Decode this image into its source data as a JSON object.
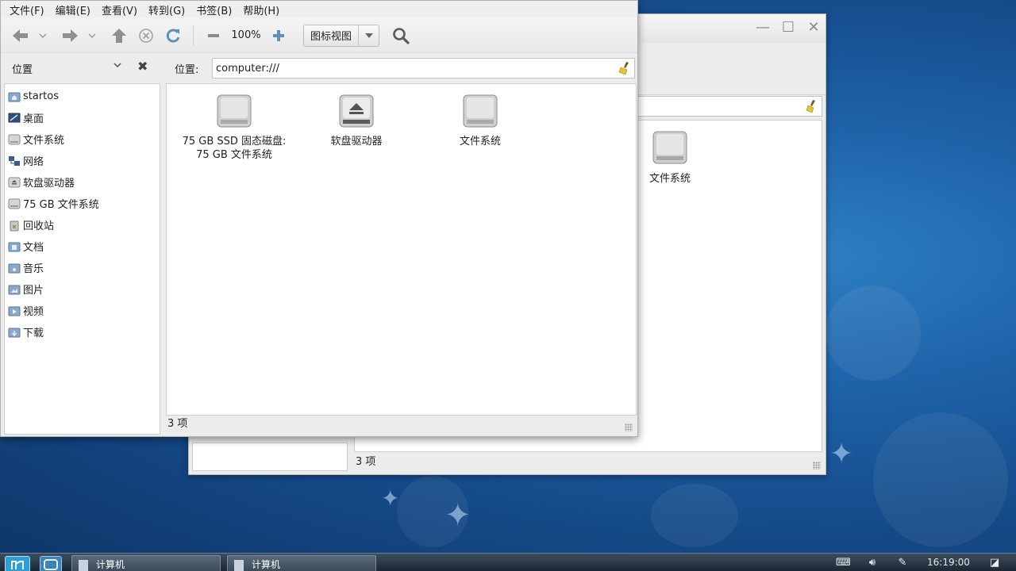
{
  "back_window": {
    "controls": {
      "minimize": "—",
      "maximize": "☐",
      "close": "✕"
    },
    "items": [
      {
        "label": "文件系统"
      }
    ],
    "status": "3 项"
  },
  "menubar": {
    "items": [
      "文件(F)",
      "编辑(E)",
      "查看(V)",
      "转到(G)",
      "书签(B)",
      "帮助(H)"
    ]
  },
  "toolbar": {
    "zoom_level": "100%",
    "view_mode": "图标视图"
  },
  "sidebar": {
    "title": "位置",
    "items": [
      {
        "label": "startos",
        "icon": "home-folder-icon"
      },
      {
        "label": "桌面",
        "icon": "desktop-icon"
      },
      {
        "label": "文件系统",
        "icon": "drive-icon"
      },
      {
        "label": "网络",
        "icon": "network-icon"
      },
      {
        "label": "软盘驱动器",
        "icon": "floppy-icon"
      },
      {
        "label": "75 GB 文件系统",
        "icon": "drive-icon"
      },
      {
        "label": "回收站",
        "icon": "trash-icon"
      },
      {
        "label": "文档",
        "icon": "folder-icon"
      },
      {
        "label": "音乐",
        "icon": "folder-icon"
      },
      {
        "label": "图片",
        "icon": "folder-icon"
      },
      {
        "label": "视频",
        "icon": "folder-icon"
      },
      {
        "label": "下载",
        "icon": "folder-icon"
      }
    ]
  },
  "location": {
    "label": "位置:",
    "value": "computer:///"
  },
  "content": {
    "items": [
      {
        "label": "75 GB SSD 固态磁盘:",
        "label2": "75 GB 文件系统",
        "icon": "drive-icon"
      },
      {
        "label": "软盘驱动器",
        "label2": "",
        "icon": "eject-drive-icon"
      },
      {
        "label": "文件系统",
        "label2": "",
        "icon": "drive-icon"
      }
    ]
  },
  "status": {
    "text": "3 项"
  },
  "taskbar": {
    "tasks": [
      "计算机",
      "计算机"
    ],
    "clock": "16:19:00"
  },
  "colors": {
    "desktop": "#1e62a8",
    "window_bg": "#ececec",
    "taskbar": "#2a3644"
  }
}
